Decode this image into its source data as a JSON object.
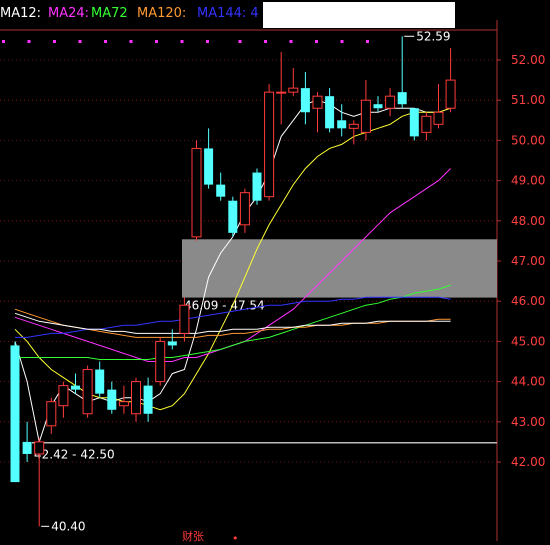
{
  "legend": [
    {
      "label": "MA12:",
      "color": "#ffffff"
    },
    {
      "label": "MA24:",
      "color": "#ff33ff"
    },
    {
      "label": "MA72",
      "color": "#33ff33"
    },
    {
      "label": "MA120:",
      "color": "#ff9933"
    },
    {
      "label": "MA144: 4",
      "color": "#3333ff"
    }
  ],
  "footer": {
    "left": "财张",
    "right": "•"
  },
  "chart_data": {
    "type": "candlestick",
    "ylim": [
      40,
      53
    ],
    "y_ticks": [
      "52.00",
      "51.00",
      "50.00",
      "49.00",
      "48.00",
      "47.00",
      "46.00",
      "45.00",
      "44.00",
      "43.00",
      "42.00"
    ],
    "grid": true,
    "candles": [
      {
        "o": 44.9,
        "h": 45.0,
        "l": 41.5,
        "c": 41.5
      },
      {
        "o": 42.5,
        "h": 43.0,
        "l": 42.0,
        "c": 42.2
      },
      {
        "o": 42.2,
        "h": 42.6,
        "l": 40.4,
        "c": 42.5
      },
      {
        "o": 42.9,
        "h": 43.6,
        "l": 42.7,
        "c": 43.5
      },
      {
        "o": 43.4,
        "h": 44.0,
        "l": 43.1,
        "c": 43.9
      },
      {
        "o": 43.9,
        "h": 44.2,
        "l": 43.7,
        "c": 43.8
      },
      {
        "o": 43.2,
        "h": 44.4,
        "l": 43.1,
        "c": 44.3
      },
      {
        "o": 44.3,
        "h": 44.5,
        "l": 43.6,
        "c": 43.7
      },
      {
        "o": 43.8,
        "h": 44.0,
        "l": 43.2,
        "c": 43.3
      },
      {
        "o": 43.4,
        "h": 43.9,
        "l": 43.2,
        "c": 43.5
      },
      {
        "o": 43.2,
        "h": 44.1,
        "l": 43.0,
        "c": 44.0
      },
      {
        "o": 43.9,
        "h": 44.1,
        "l": 43.0,
        "c": 43.2
      },
      {
        "o": 44.0,
        "h": 45.1,
        "l": 43.9,
        "c": 45.0
      },
      {
        "o": 45.0,
        "h": 45.3,
        "l": 44.8,
        "c": 44.9
      },
      {
        "o": 45.2,
        "h": 46.1,
        "l": 45.0,
        "c": 45.9
      },
      {
        "o": 47.6,
        "h": 50.0,
        "l": 47.5,
        "c": 49.8
      },
      {
        "o": 49.8,
        "h": 50.3,
        "l": 48.8,
        "c": 48.9
      },
      {
        "o": 48.9,
        "h": 49.2,
        "l": 48.5,
        "c": 48.6
      },
      {
        "o": 48.5,
        "h": 48.6,
        "l": 47.6,
        "c": 47.7
      },
      {
        "o": 47.9,
        "h": 48.8,
        "l": 47.7,
        "c": 48.7
      },
      {
        "o": 49.2,
        "h": 49.3,
        "l": 48.4,
        "c": 48.5
      },
      {
        "o": 48.6,
        "h": 51.4,
        "l": 48.5,
        "c": 51.2
      },
      {
        "o": 51.2,
        "h": 52.2,
        "l": 50.4,
        "c": 51.2
      },
      {
        "o": 51.2,
        "h": 51.8,
        "l": 51.1,
        "c": 51.3
      },
      {
        "o": 51.3,
        "h": 51.7,
        "l": 50.4,
        "c": 50.7
      },
      {
        "o": 50.8,
        "h": 51.2,
        "l": 50.2,
        "c": 51.1
      },
      {
        "o": 51.1,
        "h": 51.3,
        "l": 50.2,
        "c": 50.3
      },
      {
        "o": 50.5,
        "h": 50.9,
        "l": 50.1,
        "c": 50.3
      },
      {
        "o": 50.3,
        "h": 50.5,
        "l": 49.9,
        "c": 50.4
      },
      {
        "o": 50.2,
        "h": 51.5,
        "l": 50.0,
        "c": 51.0
      },
      {
        "o": 50.9,
        "h": 51.1,
        "l": 50.7,
        "c": 50.8
      },
      {
        "o": 50.8,
        "h": 51.3,
        "l": 50.6,
        "c": 51.1
      },
      {
        "o": 51.2,
        "h": 52.59,
        "l": 50.8,
        "c": 50.9
      },
      {
        "o": 50.8,
        "h": 50.8,
        "l": 50.0,
        "c": 50.1
      },
      {
        "o": 50.2,
        "h": 50.7,
        "l": 50.0,
        "c": 50.6
      },
      {
        "o": 50.4,
        "h": 51.4,
        "l": 50.3,
        "c": 50.7
      },
      {
        "o": 50.8,
        "h": 52.3,
        "l": 50.7,
        "c": 51.5
      }
    ],
    "series": [
      {
        "color": "#ffffff",
        "values": [
          45.0,
          44.0,
          42.5,
          43.4,
          43.9,
          43.7,
          43.5,
          43.6,
          43.5,
          43.6,
          43.6,
          43.5,
          43.7,
          44.2,
          44.3,
          45.3,
          46.6,
          47.2,
          47.6,
          48.2,
          48.6,
          49.2,
          50.1,
          50.5,
          50.9,
          51.0,
          50.9,
          50.7,
          50.6,
          50.7,
          50.7,
          50.8,
          50.8,
          50.8,
          50.7,
          50.7,
          50.8
        ]
      },
      {
        "color": "#ffff33",
        "values": [
          45.3,
          45.0,
          44.6,
          44.3,
          44.1,
          43.9,
          43.7,
          43.6,
          43.6,
          43.5,
          43.5,
          43.4,
          43.3,
          43.4,
          43.7,
          44.2,
          44.7,
          45.3,
          45.9,
          46.6,
          47.3,
          47.9,
          48.4,
          48.9,
          49.3,
          49.6,
          49.8,
          49.9,
          50.1,
          50.2,
          50.3,
          50.4,
          50.6,
          50.7,
          50.7,
          50.7,
          50.8
        ]
      },
      {
        "color": "#ff33ff",
        "values": [
          45.6,
          45.5,
          45.4,
          45.3,
          45.2,
          45.1,
          45.0,
          44.9,
          44.8,
          44.7,
          44.6,
          44.5,
          44.5,
          44.5,
          44.6,
          44.6,
          44.7,
          44.8,
          44.9,
          45.0,
          45.2,
          45.4,
          45.6,
          45.8,
          46.1,
          46.4,
          46.7,
          47.0,
          47.3,
          47.6,
          47.9,
          48.2,
          48.4,
          48.6,
          48.8,
          49.0,
          49.3
        ]
      },
      {
        "color": "#33ff33",
        "values": [
          44.6,
          44.6,
          44.6,
          44.6,
          44.6,
          44.6,
          44.6,
          44.55,
          44.55,
          44.55,
          44.55,
          44.55,
          44.6,
          44.6,
          44.65,
          44.7,
          44.75,
          44.8,
          44.9,
          45.0,
          45.05,
          45.1,
          45.2,
          45.3,
          45.4,
          45.5,
          45.6,
          45.7,
          45.8,
          45.9,
          45.95,
          46.05,
          46.1,
          46.2,
          46.25,
          46.3,
          46.4
        ]
      },
      {
        "color": "#ff9933",
        "values": [
          45.8,
          45.7,
          45.6,
          45.5,
          45.4,
          45.35,
          45.3,
          45.25,
          45.2,
          45.15,
          45.1,
          45.1,
          45.1,
          45.1,
          45.1,
          45.1,
          45.15,
          45.15,
          45.2,
          45.2,
          45.25,
          45.3,
          45.3,
          45.35,
          45.35,
          45.4,
          45.4,
          45.4,
          45.45,
          45.45,
          45.45,
          45.5,
          45.5,
          45.5,
          45.5,
          45.55,
          45.55
        ]
      },
      {
        "color": "#3333ff",
        "values": [
          45.1,
          45.1,
          45.15,
          45.2,
          45.2,
          45.25,
          45.3,
          45.3,
          45.35,
          45.4,
          45.4,
          45.45,
          45.5,
          45.5,
          45.55,
          45.6,
          45.65,
          45.7,
          45.75,
          45.8,
          45.85,
          45.9,
          45.9,
          45.95,
          46.0,
          46.0,
          46.0,
          46.05,
          46.05,
          46.1,
          46.1,
          46.1,
          46.1,
          46.1,
          46.1,
          46.1,
          46.05
        ]
      },
      {
        "color": "#ffffff",
        "values": [
          45.7,
          45.6,
          45.5,
          45.45,
          45.4,
          45.35,
          45.3,
          45.3,
          45.25,
          45.25,
          45.2,
          45.2,
          45.2,
          45.2,
          45.2,
          45.2,
          45.25,
          45.25,
          45.3,
          45.3,
          45.3,
          45.35,
          45.35,
          45.35,
          45.4,
          45.4,
          45.4,
          45.45,
          45.45,
          45.45,
          45.5,
          45.5,
          45.5,
          45.5,
          45.5,
          45.5,
          45.5
        ]
      }
    ],
    "zone": {
      "low": 46.09,
      "high": 47.54,
      "label": "46.09 - 47.54"
    },
    "lower_line": {
      "price": 42.48,
      "label": "42.42 - 42.50"
    },
    "high_label": "52.59",
    "low_label": "40.40"
  }
}
